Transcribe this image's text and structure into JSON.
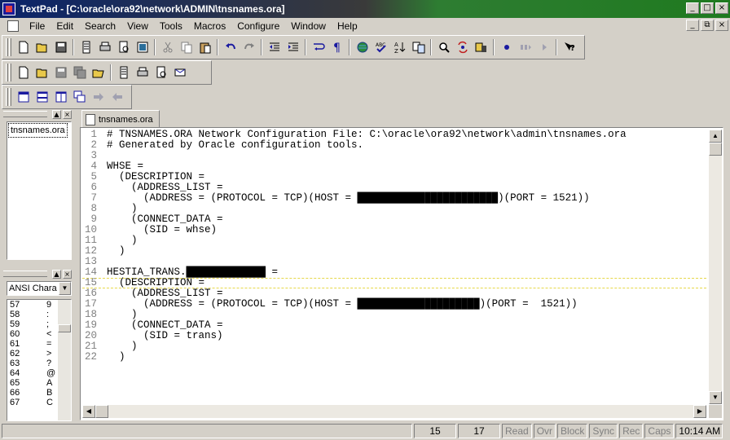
{
  "window": {
    "title": "TextPad - [C:\\oracle\\ora92\\network\\ADMIN\\tnsnames.ora]",
    "controls": [
      "_",
      "□",
      "×"
    ],
    "mdi_controls": [
      "_",
      "⧉",
      "×"
    ]
  },
  "menu": [
    "File",
    "Edit",
    "Search",
    "View",
    "Tools",
    "Macros",
    "Configure",
    "Window",
    "Help"
  ],
  "toolbar1_icons": [
    "new-file-icon",
    "open-file-icon",
    "save-icon",
    "document-properties-icon",
    "print-icon",
    "print-preview-icon",
    "manage-files-icon",
    "cut-icon",
    "copy-icon",
    "paste-icon",
    "undo-icon",
    "redo-icon",
    "decrease-indent-icon",
    "increase-indent-icon",
    "word-wrap-icon",
    "show-paragraph-icon",
    "web-icon",
    "spell-check-icon",
    "sort-icon",
    "compare-icon",
    "find-icon",
    "replace-icon",
    "find-in-files-icon",
    "record-macro-icon",
    "play-macro-icon",
    "step-icon",
    "help-icon"
  ],
  "toolbar2_icons": [
    "new-file-icon",
    "open-file-icon",
    "save-icon",
    "save-all-icon",
    "open-folder-icon",
    "document-properties-icon",
    "print-icon",
    "print-preview-icon",
    "email-icon"
  ],
  "toolbar3_icons": [
    "tile-icon",
    "horizontal-split-icon",
    "vertical-split-icon",
    "cascade-icon",
    "next-window-icon",
    "previous-window-icon"
  ],
  "document_selector": {
    "items": [
      "tnsnames.ora"
    ]
  },
  "clip_library": {
    "selected": "ANSI Chara",
    "rows": [
      {
        "code": "57",
        "char": "9"
      },
      {
        "code": "58",
        "char": ":"
      },
      {
        "code": "59",
        "char": ";"
      },
      {
        "code": "60",
        "char": "<"
      },
      {
        "code": "61",
        "char": "="
      },
      {
        "code": "62",
        "char": ">"
      },
      {
        "code": "63",
        "char": "?"
      },
      {
        "code": "64",
        "char": "@"
      },
      {
        "code": "65",
        "char": "A"
      },
      {
        "code": "66",
        "char": "B"
      },
      {
        "code": "67",
        "char": "C"
      }
    ]
  },
  "tab": {
    "label": "tnsnames.ora"
  },
  "editor": {
    "current_line": 15,
    "lines": [
      "# TNSNAMES.ORA Network Configuration File: C:\\oracle\\ora92\\network\\admin\\tnsnames.ora",
      "# Generated by Oracle configuration tools.",
      "",
      "WHSE =",
      "  (DESCRIPTION =",
      "    (ADDRESS_LIST =",
      "      (ADDRESS = (PROTOCOL = TCP)(HOST = ███████████████████████)(PORT = 1521))",
      "    )",
      "    (CONNECT_DATA =",
      "      (SID = whse)",
      "    )",
      "  )",
      "",
      "HESTIA_TRANS.█████████████ =",
      "  (DESCRIPTION =",
      "    (ADDRESS_LIST =",
      "      (ADDRESS = (PROTOCOL = TCP)(HOST = ████████████████████)(PORT =  1521))",
      "    )",
      "    (CONNECT_DATA =",
      "      (SID = trans)",
      "    )",
      "  )"
    ]
  },
  "status": {
    "line": "15",
    "column": "17",
    "read": "Read",
    "ovr": "Ovr",
    "block": "Block",
    "sync": "Sync",
    "rec": "Rec",
    "caps": "Caps",
    "time": "10:14 AM"
  }
}
